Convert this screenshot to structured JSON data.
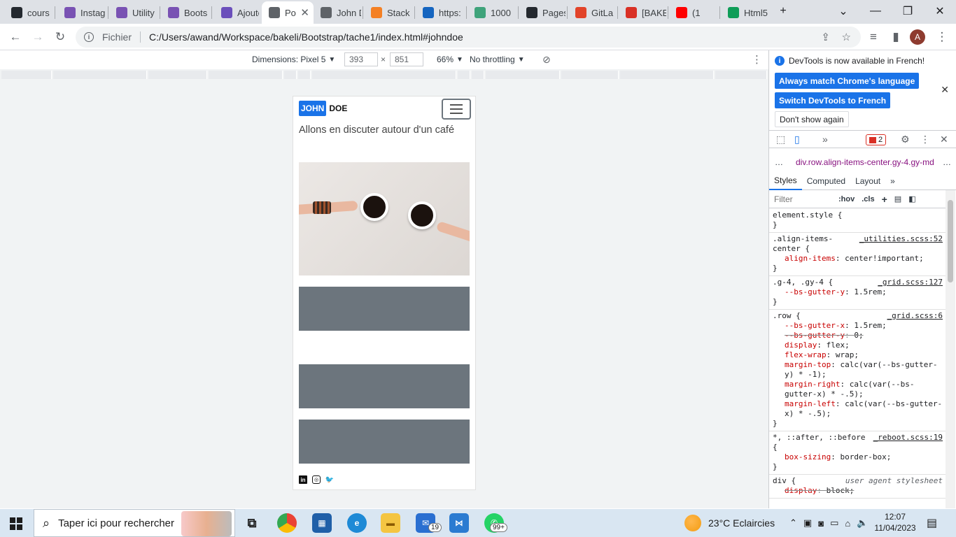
{
  "tabs": [
    {
      "label": "cours",
      "icon": "github-icon",
      "color": "#24292f"
    },
    {
      "label": "Instag",
      "icon": "bootstrap-icon",
      "color": "#7952b3"
    },
    {
      "label": "Utility",
      "icon": "bootstrap-icon",
      "color": "#7952b3"
    },
    {
      "label": "Boots",
      "icon": "bootstrap-icon",
      "color": "#7952b3"
    },
    {
      "label": "Ajoute",
      "icon": "d-icon",
      "color": "#6b4fbb"
    },
    {
      "label": "Po",
      "icon": "globe-icon",
      "color": "#5f6368"
    },
    {
      "label": "John D",
      "icon": "globe-icon",
      "color": "#5f6368"
    },
    {
      "label": "Stack",
      "icon": "stackoverflow-icon",
      "color": "#f48024"
    },
    {
      "label": "https:",
      "icon": "f-icon",
      "color": "#1565c0"
    },
    {
      "label": "1000",
      "icon": "d-icon",
      "color": "#3fa37b"
    },
    {
      "label": "Pages",
      "icon": "github-icon",
      "color": "#24292f"
    },
    {
      "label": "GitLa",
      "icon": "gitlab-icon",
      "color": "#e24329"
    },
    {
      "label": "[BAKE",
      "icon": "gmail-icon",
      "color": "#d93025"
    },
    {
      "label": "(1",
      "icon": "youtube-icon",
      "color": "#ff0000"
    },
    {
      "label": "Html5",
      "icon": "sheets-icon",
      "color": "#0f9d58"
    }
  ],
  "omnibox": {
    "scheme": "Fichier",
    "url": "C:/Users/awand/Workspace/bakeli/Bootstrap/tache1/index.html#johndoe"
  },
  "profile_initial": "A",
  "devicebar": {
    "dimensions_label": "Dimensions: Pixel 5",
    "width": "393",
    "height": "851",
    "times": "×",
    "zoom": "66%",
    "throttling": "No throttling"
  },
  "site": {
    "brand_primary": "JOHN",
    "brand_secondary": "DOE",
    "tagline": "Allons en discuter autour d'un café",
    "socials": [
      "in",
      "◎",
      "🐦"
    ]
  },
  "devtools": {
    "notice": "DevTools is now available in French!",
    "btn_match": "Always match Chrome's language",
    "btn_switch": "Switch DevTools to French",
    "btn_dont_show": "Don't show again",
    "issues_count": "2",
    "breadcrumb": "div.row.align-items-center.gy-4.gy-md",
    "subtabs": [
      "Styles",
      "Computed",
      "Layout"
    ],
    "filter_placeholder": "Filter",
    "hov": ":hov",
    "cls": ".cls",
    "rules": [
      {
        "selector": "element.style {",
        "source": "",
        "props": [],
        "close": "}"
      },
      {
        "selector": ".align-items-center {",
        "source": "_utilities.scss:52",
        "props": [
          {
            "name": "align-items",
            "value": "center!important;",
            "strike": false
          }
        ],
        "close": "}"
      },
      {
        "selector": ".g-4, .gy-4 {",
        "source": "_grid.scss:127",
        "props": [
          {
            "name": "--bs-gutter-y",
            "value": "1.5rem;",
            "strike": false
          }
        ],
        "close": "}"
      },
      {
        "selector": ".row {",
        "source": "_grid.scss:6",
        "props": [
          {
            "name": "--bs-gutter-x",
            "value": "1.5rem;",
            "strike": false
          },
          {
            "name": "--bs-gutter-y",
            "value": "0;",
            "strike": true
          },
          {
            "name": "display",
            "value": "flex;",
            "strike": false
          },
          {
            "name": "flex-wrap",
            "value": "wrap;",
            "strike": false
          },
          {
            "name": "margin-top",
            "value": "calc(var(--bs-gutter-y) * -1);",
            "strike": false
          },
          {
            "name": "margin-right",
            "value": "calc(var(--bs-gutter-x) * -.5);",
            "strike": false
          },
          {
            "name": "margin-left",
            "value": "calc(var(--bs-gutter-x) * -.5);",
            "strike": false
          }
        ],
        "close": "}"
      },
      {
        "selector": "*, ::after, ::before {",
        "source": "_reboot.scss:19",
        "props": [
          {
            "name": "box-sizing",
            "value": "border-box;",
            "strike": false
          }
        ],
        "close": "}"
      },
      {
        "selector": "div {",
        "source": "user agent stylesheet",
        "props": [
          {
            "name": "display",
            "value": "block;",
            "strike": true
          }
        ],
        "close": ""
      }
    ]
  },
  "taskbar": {
    "search_placeholder": "Taper ici pour rechercher",
    "mail_badge": "19",
    "whatsapp_badge": "99+",
    "weather": "23°C  Eclaircies",
    "time": "12:07",
    "date": "11/04/2023"
  }
}
